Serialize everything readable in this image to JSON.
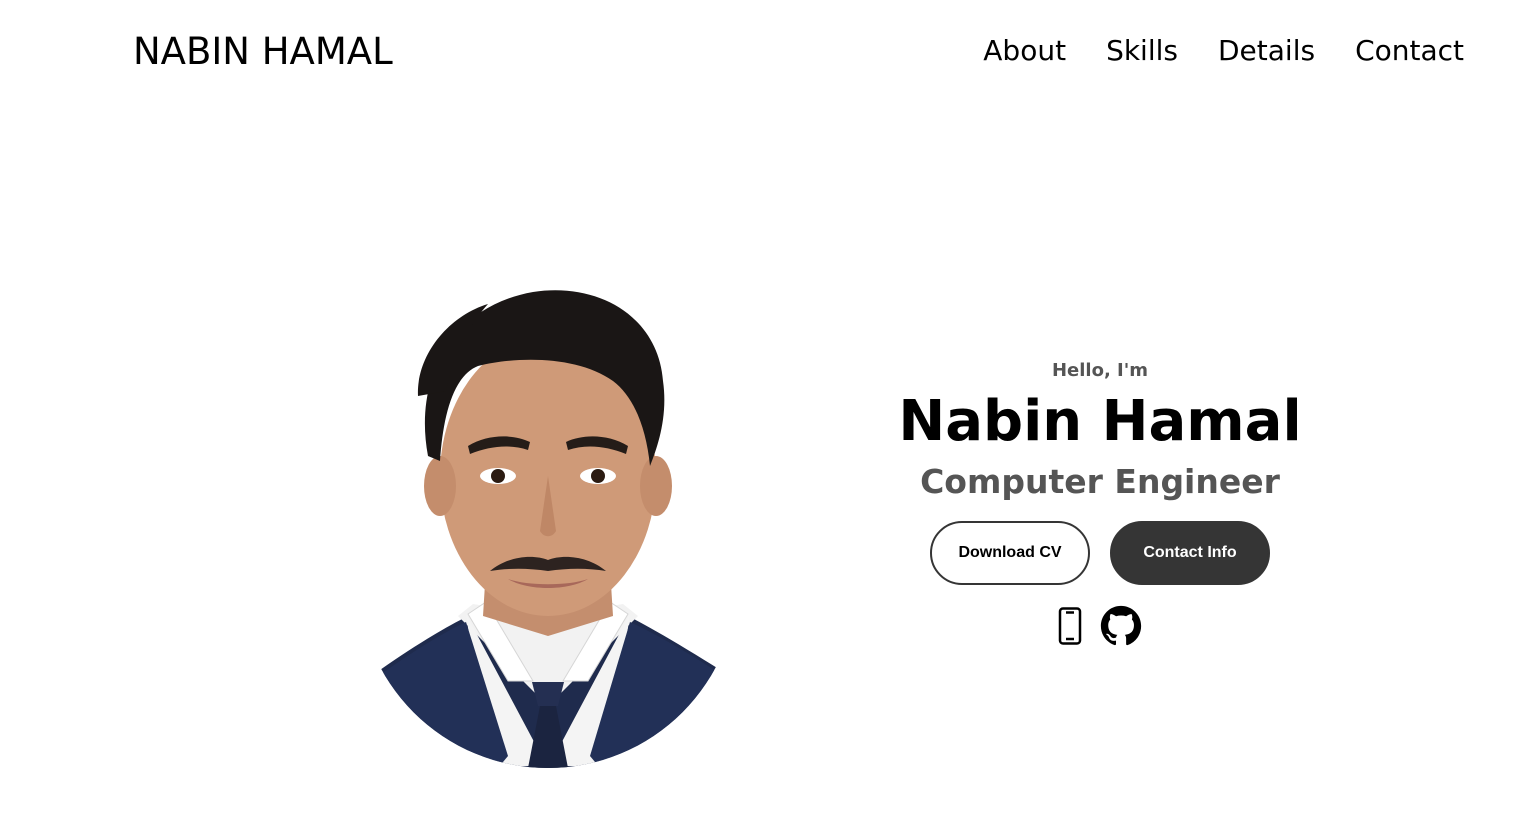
{
  "header": {
    "logo": "NABIN HAMAL",
    "nav": [
      {
        "label": "About"
      },
      {
        "label": "Skills"
      },
      {
        "label": "Details"
      },
      {
        "label": "Contact"
      }
    ]
  },
  "hero": {
    "greeting": "Hello, I'm",
    "name": "Nabin Hamal",
    "title": "Computer Engineer",
    "buttons": {
      "download_cv": "Download CV",
      "contact_info": "Contact Info"
    },
    "socials": [
      {
        "icon": "mobile-phone-icon"
      },
      {
        "icon": "github-icon"
      }
    ]
  },
  "colors": {
    "primary_dark": "#353535",
    "subtitle_gray": "#555555"
  }
}
